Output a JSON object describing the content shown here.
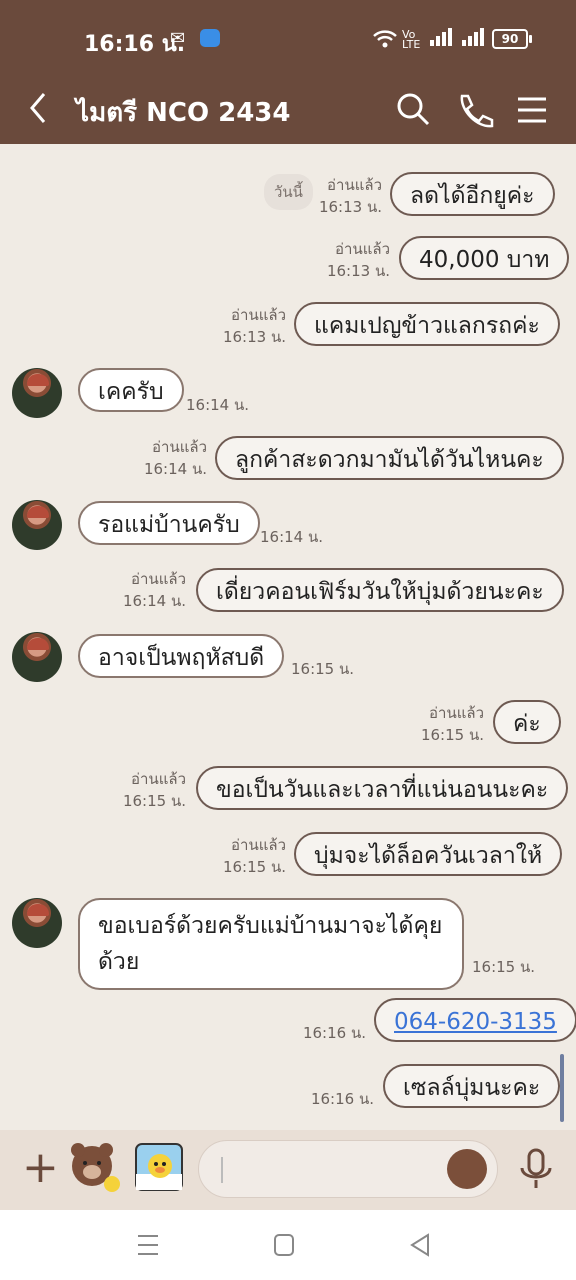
{
  "status": {
    "time": "16:16 น.",
    "battery": "90",
    "icons": [
      "notification-icon",
      "app-icon",
      "wifi-icon",
      "volte-icon",
      "signal-icon",
      "signal-icon-2",
      "battery-icon"
    ]
  },
  "header": {
    "title": "ไมตรี  NCO 2434",
    "icons": [
      "back-icon",
      "search-icon",
      "call-icon",
      "menu-icon"
    ]
  },
  "date_chip": "วันนี้",
  "messages": [
    {
      "dir": "out",
      "text": "ลดได้อีกยูค่ะ",
      "read": "อ่านแล้ว",
      "time": "16:13 น."
    },
    {
      "dir": "out",
      "text": "40,000 บาท",
      "read": "อ่านแล้ว",
      "time": "16:13 น."
    },
    {
      "dir": "out",
      "text": "แคมเปญข้าวแลกรถค่ะ",
      "read": "อ่านแล้ว",
      "time": "16:13 น."
    },
    {
      "dir": "in",
      "text": "เคครับ",
      "time": "16:14 น."
    },
    {
      "dir": "out",
      "text": "ลูกค้าสะดวกมามันได้วันไหนคะ",
      "read": "อ่านแล้ว",
      "time": "16:14 น."
    },
    {
      "dir": "in",
      "text": "รอแม่บ้านครับ",
      "time": "16:14 น."
    },
    {
      "dir": "out",
      "text": "เดี่ยวคอนเฟิร์มวันให้บุ่มด้วยนะคะ",
      "read": "อ่านแล้ว",
      "time": "16:14 น."
    },
    {
      "dir": "in",
      "text": "อาจเป็นพฤหัสบดี",
      "time": "16:15 น."
    },
    {
      "dir": "out",
      "text": "ค่ะ",
      "read": "อ่านแล้ว",
      "time": "16:15 น."
    },
    {
      "dir": "out",
      "text": "ขอเป็นวันและเวลาที่แน่นอนนะคะ",
      "read": "อ่านแล้ว",
      "time": "16:15 น."
    },
    {
      "dir": "out",
      "text": "บุ่มจะได้ล็อควันเวลาให้",
      "read": "อ่านแล้ว",
      "time": "16:15 น."
    },
    {
      "dir": "in",
      "text": "ขอเบอร์ด้วยครับแม่บ้านมาจะได้คุยด้วย",
      "time": "16:15 น."
    },
    {
      "dir": "out",
      "text": "064-620-3135",
      "time": "16:16 น.",
      "link": true
    },
    {
      "dir": "out",
      "text": "เซลล์บุ่มนะคะ",
      "time": "16:16 น."
    }
  ],
  "input": {
    "placeholder": ""
  },
  "colors": {
    "header": "#6a4a3c",
    "chat_bg": "#f0ebe4",
    "link": "#3a73d6"
  }
}
